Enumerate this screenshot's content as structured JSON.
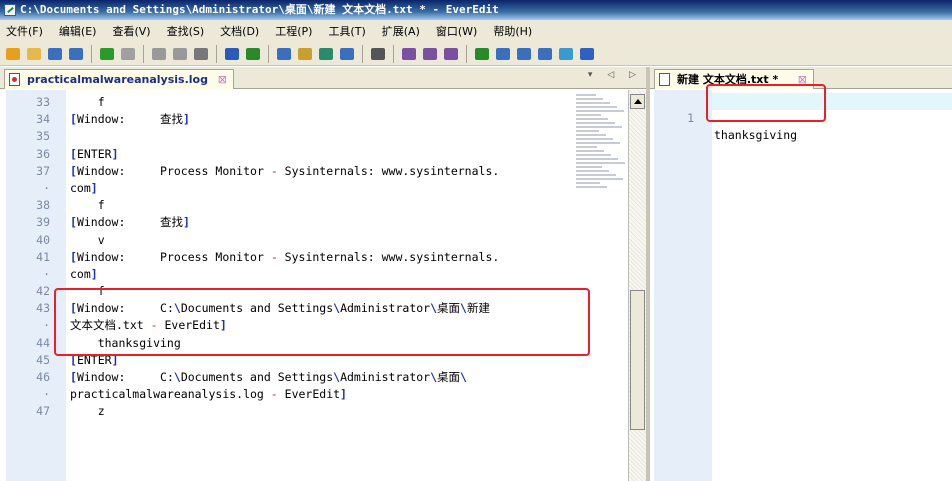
{
  "window": {
    "title": "C:\\Documents and Settings\\Administrator\\桌面\\新建 文本文档.txt * - EverEdit"
  },
  "menu": [
    "文件(F)",
    "编辑(E)",
    "查看(V)",
    "查找(S)",
    "文档(D)",
    "工程(P)",
    "工具(T)",
    "扩展(A)",
    "窗口(W)",
    "帮助(H)"
  ],
  "toolbar": {
    "icons": [
      "new-icon",
      "open-icon",
      "save-icon",
      "save-all-icon",
      "undo-icon",
      "redo-icon",
      "cut-icon",
      "copy-icon",
      "paste-icon",
      "format-icon",
      "wrap-icon",
      "find-icon",
      "find-replace-icon",
      "goto-icon",
      "bookmark-icon",
      "hex-icon",
      "macro-record-icon",
      "macro-play-icon",
      "macro-stop-icon",
      "outline-icon",
      "split-icon",
      "fullscreen-icon",
      "column-icon",
      "browser-icon",
      "heart-icon"
    ],
    "colors": [
      "#e6a020",
      "#e7b84a",
      "#3a6fc0",
      "#3a6fc0",
      "#2a9a2a",
      "#a0a0a0",
      "#999999",
      "#999999",
      "#777777",
      "#2a5bb8",
      "#2a8a2a",
      "#3a6fc0",
      "#c9a030",
      "#2a8a6a",
      "#3a6fc0",
      "#555555",
      "#7a50a0",
      "#7a50a0",
      "#7a50a0",
      "#2a8a2a",
      "#3a6fc0",
      "#3a6fc0",
      "#3a6fc0",
      "#3a9ad0",
      "#3060c0"
    ]
  },
  "tabs": {
    "left": {
      "label": "practicalmalwareanalysis.log",
      "close": "⊠",
      "nav": "▾ ◁ ▷"
    },
    "right": {
      "label": "新建 文本文档.txt *",
      "close": "⊠"
    }
  },
  "left_editor": {
    "lines": [
      {
        "num": "33",
        "text": "    f"
      },
      {
        "num": "34",
        "text": "[Window:     查找]"
      },
      {
        "num": "35",
        "text": ""
      },
      {
        "num": "36",
        "text": "[ENTER]"
      },
      {
        "num": "37",
        "text": "[Window:     Process Monitor - Sysinternals: www.sysinternals."
      },
      {
        "num": "·",
        "text": "com]"
      },
      {
        "num": "38",
        "text": "    f"
      },
      {
        "num": "39",
        "text": "[Window:     查找]"
      },
      {
        "num": "40",
        "text": "    v"
      },
      {
        "num": "41",
        "text": "[Window:     Process Monitor - Sysinternals: www.sysinternals."
      },
      {
        "num": "·",
        "text": "com]"
      },
      {
        "num": "42",
        "text": "    f"
      },
      {
        "num": "43",
        "text": "[Window:     C:\\Documents and Settings\\Administrator\\桌面\\新建"
      },
      {
        "num": "·",
        "text": "文本文档.txt - EverEdit]"
      },
      {
        "num": "44",
        "text": "    thanksgiving"
      },
      {
        "num": "45",
        "text": "[ENTER]"
      },
      {
        "num": "46",
        "text": "[Window:     C:\\Documents and Settings\\Administrator\\桌面\\"
      },
      {
        "num": "·",
        "text": "practicalmalwareanalysis.log - EverEdit]"
      },
      {
        "num": "47",
        "text": "    z"
      }
    ]
  },
  "right_editor": {
    "line_num": "1",
    "text": "thanksgiving"
  },
  "highlight_color": "#e8202a"
}
